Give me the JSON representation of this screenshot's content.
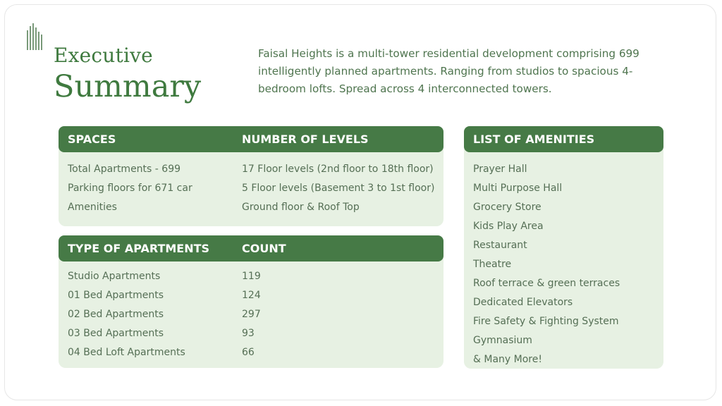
{
  "title": {
    "line1": "Executive",
    "line2": "Summary"
  },
  "intro": "Faisal Heights is a multi-tower residential development comprising 699 intelligently planned apartments. Ranging from studios to spacious 4-bedroom lofts. Spread across 4 interconnected towers.",
  "spaces": {
    "headers": [
      "SPACES",
      "NUMBER OF LEVELS"
    ],
    "rows": [
      [
        "Total Apartments - 699",
        "17 Floor levels (2nd floor to 18th floor)"
      ],
      [
        "Parking floors for 671 car",
        "5 Floor levels (Basement 3 to 1st floor)"
      ],
      [
        "Amenities",
        "Ground floor & Roof Top"
      ]
    ]
  },
  "apartments": {
    "headers": [
      "TYPE OF APARTMENTS",
      "COUNT"
    ],
    "rows": [
      [
        "Studio Apartments",
        "119"
      ],
      [
        "01 Bed Apartments",
        "124"
      ],
      [
        "02 Bed Apartments",
        "297"
      ],
      [
        "03 Bed Apartments",
        "93"
      ],
      [
        "04 Bed Loft Apartments",
        "66"
      ]
    ]
  },
  "amenities": {
    "header": "LIST OF AMENITIES",
    "items": [
      "Prayer Hall",
      "Multi Purpose Hall",
      "Grocery Store",
      "Kids Play Area",
      "Restaurant",
      "Theatre",
      "Roof terrace & green terraces",
      "Dedicated Elevators",
      "Fire Safety & Fighting System",
      "Gymnasium",
      "& Many More!"
    ]
  },
  "colors": {
    "accent": "#467a46",
    "panel": "#e7f1e3",
    "title": "#3f7a3f"
  },
  "icons": {
    "logo": "building-towers-icon"
  }
}
